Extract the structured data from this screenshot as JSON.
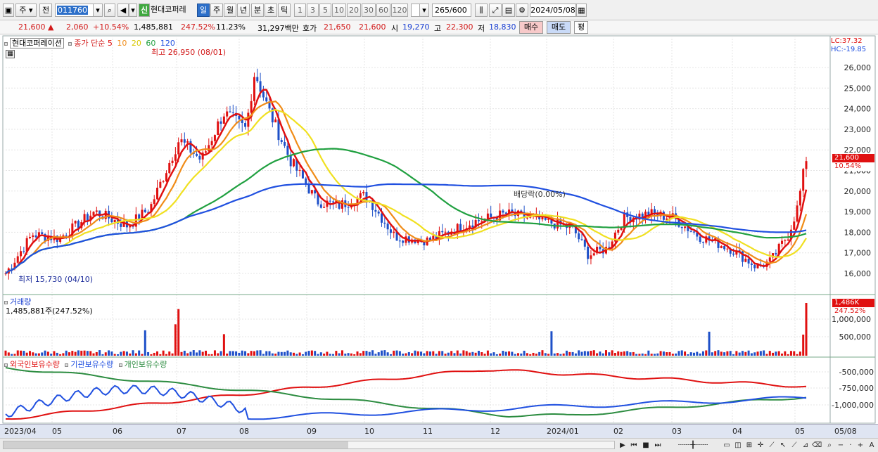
{
  "toolbar": {
    "market_label": "주",
    "prefix_label": "전",
    "code_value": "011760",
    "new_badge": "신",
    "company_name": "현대코퍼레",
    "periods": [
      "일",
      "주",
      "월",
      "년",
      "분",
      "초",
      "틱"
    ],
    "intervals": [
      "1",
      "3",
      "5",
      "10",
      "20",
      "30",
      "60",
      "120"
    ],
    "count_value": "265",
    "count_total": "/600",
    "date_value": "2024/05/08"
  },
  "quote": {
    "price": "21,600",
    "change_arrow": "▲",
    "change": "2,060",
    "change_pct": "+10.54%",
    "volume": "1,485,881",
    "volume_ratio": "247.52%",
    "turnover": "11.23%",
    "amount": "31,297백만",
    "bid_label": "호가",
    "ask_price": "21,650",
    "bid_price": "21,600",
    "open_label": "시",
    "open": "19,270",
    "high_label": "고",
    "high": "22,300",
    "low_label": "저",
    "low": "18,830",
    "buy_button": "매수",
    "sell_button": "매도",
    "avg_button": "평"
  },
  "price_panel": {
    "stock_name": "현대코퍼레이션",
    "ma_title": "종가 단순",
    "ma_periods": [
      "5",
      "10",
      "20",
      "60",
      "120"
    ],
    "ma_colors": [
      "#e01010",
      "#f08c18",
      "#f0e020",
      "#20a040",
      "#2050e0"
    ],
    "high_annotation": "최고 26,950 (08/01)",
    "low_annotation": "최저 15,730 (04/10)",
    "dividend_annotation": "배당락(0.00%)",
    "lc": "LC:37.32",
    "hc": "HC:-19.85",
    "y_ticks": [
      "26,000",
      "25,000",
      "24,000",
      "23,000",
      "22,000",
      "21,000",
      "20,000",
      "19,000",
      "18,000",
      "17,000",
      "16,000"
    ],
    "current_price_tag": "21,600",
    "current_pct_tag": "10.54%"
  },
  "volume_panel": {
    "title": "거래량",
    "value": "1,485,881주(247.52%)",
    "tag_value": "1,486K",
    "tag_pct": "247.52%",
    "y_ticks": [
      "1,000,000",
      "500,000"
    ]
  },
  "holdings_panel": {
    "series": [
      "외국인보유수량",
      "기관보유수량",
      "개인보유수량"
    ],
    "colors": [
      "#e01010",
      "#2050e0",
      "#20a040"
    ],
    "y_ticks": [
      "-500,000",
      "-750,000",
      "-1,000,000"
    ]
  },
  "date_axis": [
    "2023/04",
    "05",
    "06",
    "07",
    "08",
    "09",
    "10",
    "11",
    "12",
    "2024/01",
    "02",
    "03",
    "04",
    "05",
    "05/08"
  ]
}
